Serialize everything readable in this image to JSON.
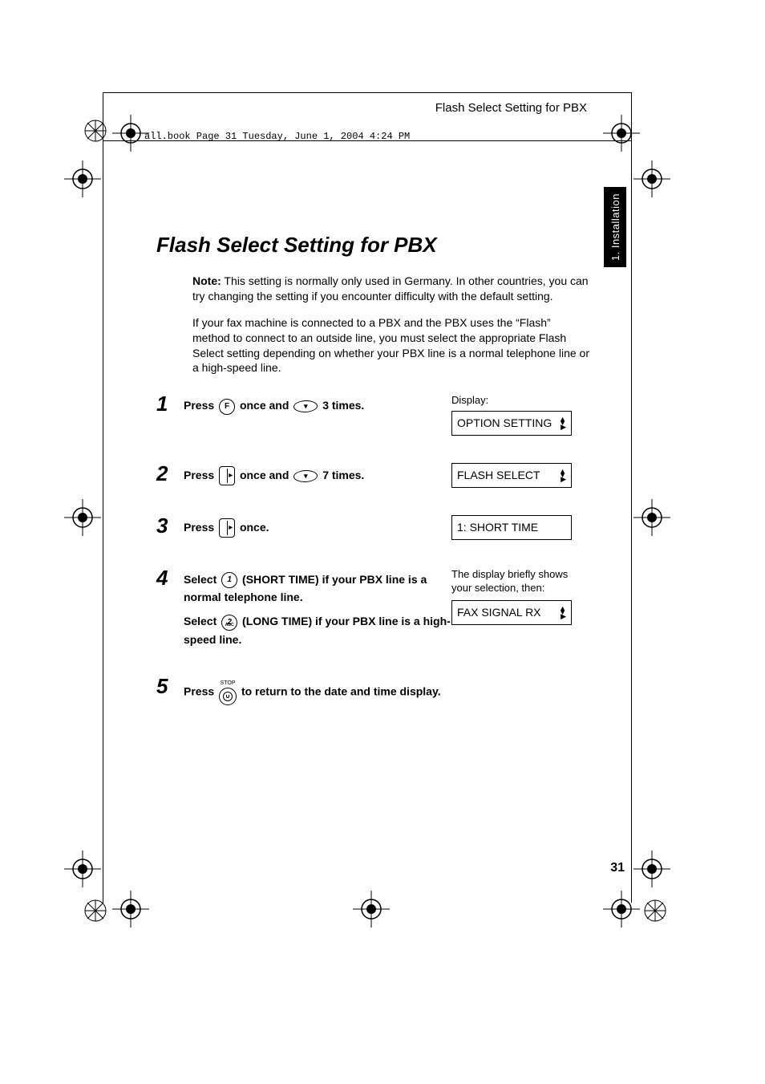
{
  "meta": {
    "book_line": "all.book  Page 31  Tuesday, June 1, 2004  4:24 PM"
  },
  "running_head": "Flash Select Setting for PBX",
  "side_tab": "1. Installation",
  "title": "Flash Select Setting for PBX",
  "intro": {
    "note_label": "Note:",
    "note_text": " This setting is normally only used in Germany. In other countries, you can try changing the setting if you encounter difficulty with the default setting.",
    "p2": "If your fax machine is connected to a PBX and the PBX uses the “Flash” method to connect to an outside line, you must select the appropriate Flash Select setting depending on whether your PBX line is a normal telephone line or a high-speed line."
  },
  "steps": {
    "s1": {
      "num": "1",
      "t1": "Press ",
      "btn_f": "F",
      "t2": " once  and ",
      "t3": " 3 times.",
      "display_label": "Display:",
      "display_value": "OPTION SETTING"
    },
    "s2": {
      "num": "2",
      "t1": "Press ",
      "t2": " once and ",
      "t3": " 7 times.",
      "display_value": "FLASH SELECT"
    },
    "s3": {
      "num": "3",
      "t1": "Press ",
      "t2": " once.",
      "display_value": "1: SHORT TIME"
    },
    "s4": {
      "num": "4",
      "t1": "Select ",
      "btn_1": "1",
      "t2": " (SHORT TIME) if your PBX line is a normal telephone line.",
      "t3": "Select ",
      "btn_2": "2",
      "btn_2_sub": "ABC",
      "t4": " (LONG TIME) if your PBX line is a high-speed line.",
      "right_note": "The display briefly shows your selection, then:",
      "display_value": "FAX SIGNAL RX"
    },
    "s5": {
      "num": "5",
      "t1": "Press ",
      "stop_label": "STOP",
      "t2": " to return to the date and time display."
    }
  },
  "page_number": "31"
}
